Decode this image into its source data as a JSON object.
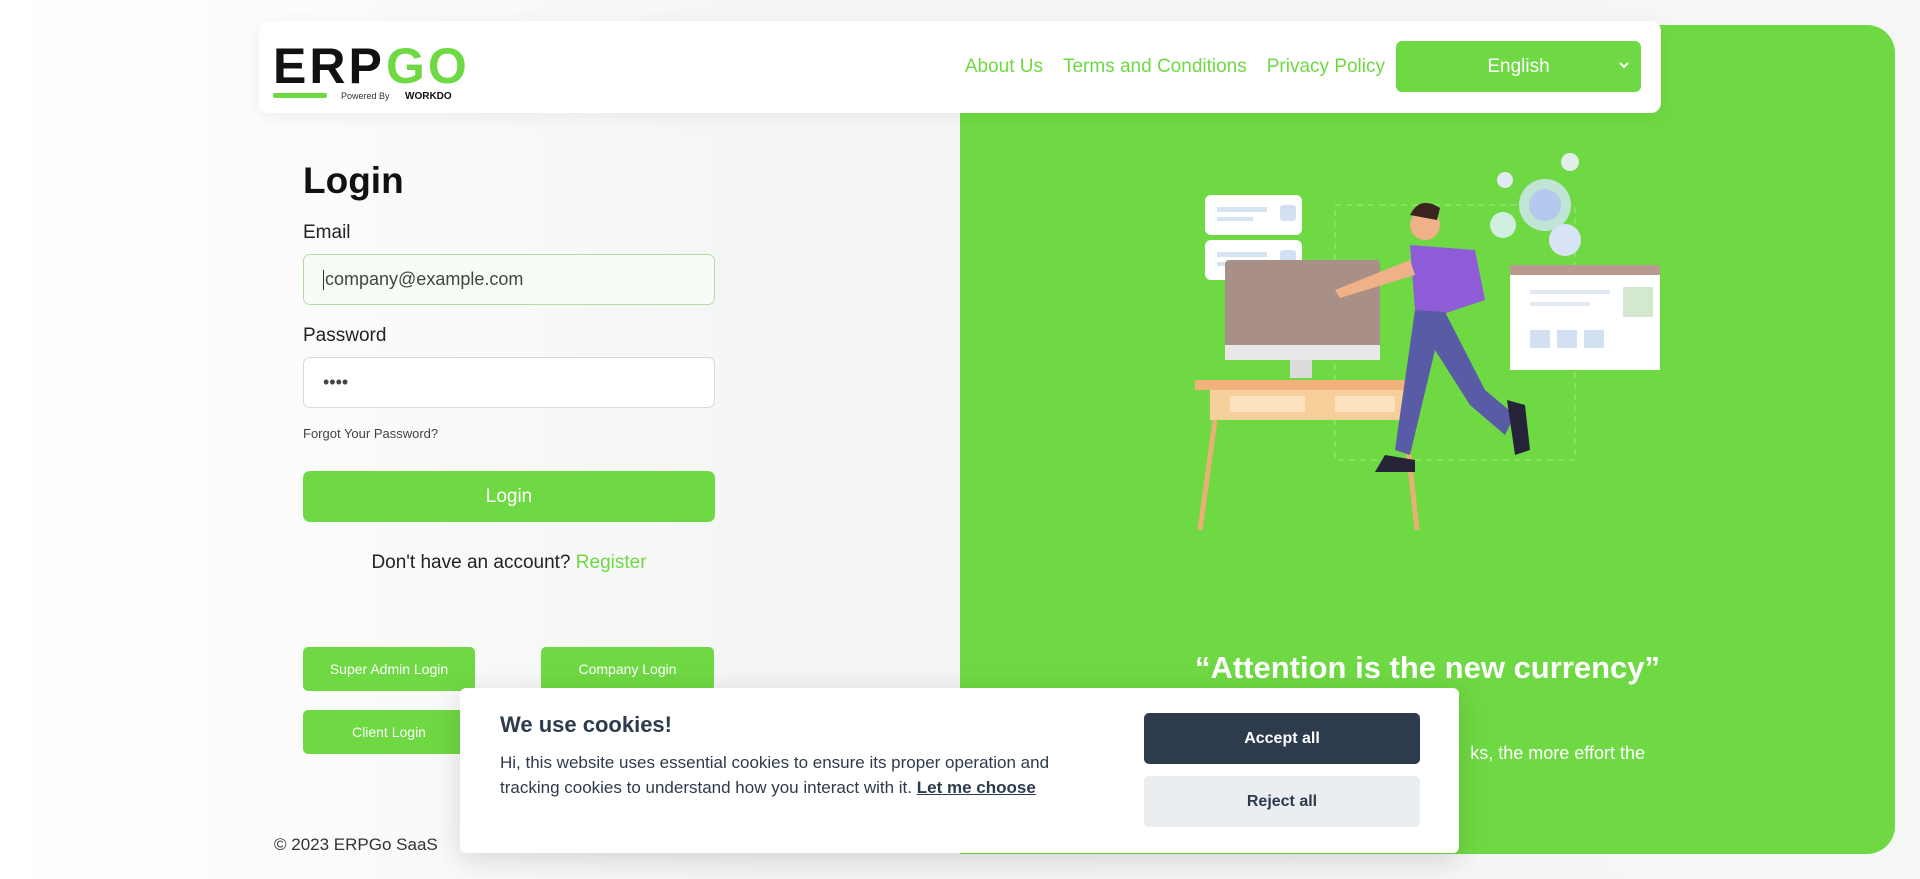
{
  "brand": {
    "logo_left": "ERP",
    "logo_right": "GO",
    "powered_by": "Powered By",
    "powered_brand": "WORKDO",
    "accent_color": "#6fd943"
  },
  "nav": {
    "links": [
      "About Us",
      "Terms and Conditions",
      "Privacy Policy"
    ],
    "language": "English"
  },
  "login": {
    "title": "Login",
    "email_label": "Email",
    "email_placeholder": "company@example.com",
    "password_label": "Password",
    "password_value": "••••",
    "forgot": "Forgot Your Password?",
    "submit": "Login",
    "no_account": "Don't have an account?",
    "register": "Register",
    "quick": {
      "super_admin": "Super Admin Login",
      "company": "Company Login",
      "client": "Client Login"
    }
  },
  "hero": {
    "quote": "“Attention is the new currency”",
    "sub_line1": "ks, the more effort the",
    "sub_line2": "."
  },
  "footer": {
    "copyright": "© 2023 ERPGo SaaS"
  },
  "cookie": {
    "title": "We use cookies!",
    "text": "Hi, this website uses essential cookies to ensure its proper operation and tracking cookies to understand how you interact with it.",
    "link": "Let me choose",
    "accept": "Accept all",
    "reject": "Reject all",
    "dark_color": "#2d3b4c"
  }
}
